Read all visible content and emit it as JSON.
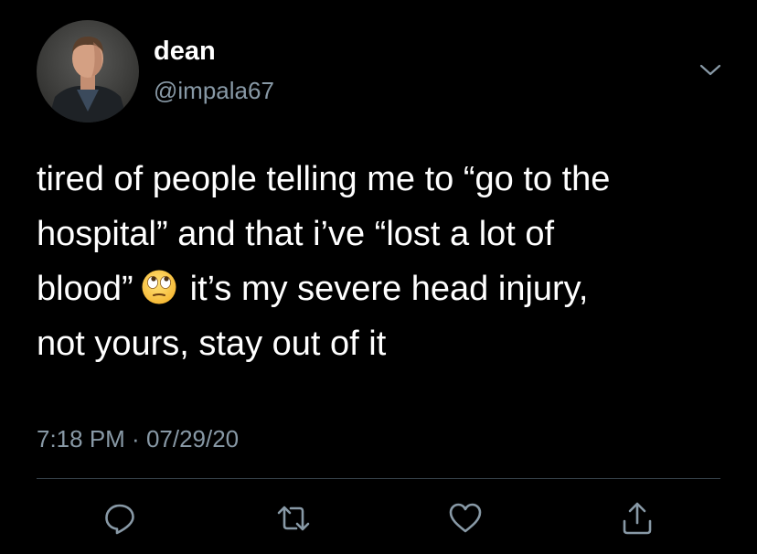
{
  "user": {
    "display_name": "dean",
    "handle": "@impala67",
    "avatar_icon": "profile-photo"
  },
  "tweet": {
    "lines": [
      "tired of people telling me to “go to the",
      "hospital” and that i’ve “lost a lot of",
      "blood”",
      "it’s my severe head injury,",
      "not yours, stay out of it"
    ],
    "emoji": "face-with-rolling-eyes-emoji"
  },
  "meta": {
    "time": "7:18 PM",
    "separator": " · ",
    "date": "07/29/20"
  },
  "actions": {
    "reply_icon": "reply-icon",
    "retweet_icon": "retweet-icon",
    "like_icon": "heart-icon",
    "share_icon": "share-icon"
  },
  "colors": {
    "background": "#000000",
    "text": "#ffffff",
    "secondary": "#8899a6",
    "divider": "#38444d"
  }
}
